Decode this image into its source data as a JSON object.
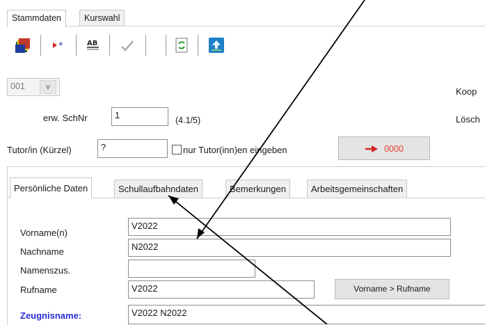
{
  "top_tabs": [
    "Stammdaten",
    "Kurswahl"
  ],
  "toolbar": {
    "icons": [
      "books-icon",
      "red-arrow-star-icon",
      "spellcheck-icon",
      "checkmark-icon",
      "refresh-document-icon",
      "upload-icon"
    ]
  },
  "combo": {
    "value": "001",
    "arrow": "v"
  },
  "right_labels": {
    "koop": "Koop",
    "losch": "Lösch"
  },
  "schnr": {
    "label": "erw. SchNr",
    "value": "1",
    "hint": "(4.1/5)"
  },
  "tutor": {
    "label": "Tutor/in (Kürzel)",
    "value": "?",
    "checkbox_label": "nur Tutor(inn)en eingeben"
  },
  "counter_button": {
    "value": "0000",
    "color": "#e53a2e"
  },
  "inner_tabs": [
    "Persönliche Daten",
    "Schullaufbahndaten",
    "Bemerkungen",
    "Arbeitsgemeinschaften"
  ],
  "form": {
    "vorname": {
      "label": "Vorname(n)",
      "value": "V2022"
    },
    "nachname": {
      "label": "Nachname",
      "value": "N2022"
    },
    "namenszus": {
      "label": "Namenszus.",
      "value": ""
    },
    "rufname": {
      "label": "Rufname",
      "value": "V2022",
      "button": "Vorname > Rufname"
    },
    "zeugnisname": {
      "label": "Zeugnisname:",
      "value": "V2022 N2022"
    }
  },
  "colors": {
    "accent_label": "#2d2bd6",
    "arrow": "#000000"
  }
}
